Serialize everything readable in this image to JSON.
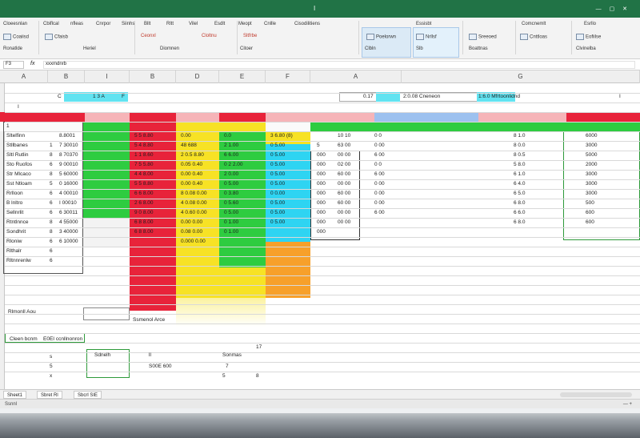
{
  "window": {
    "title": "I",
    "controls": "— ▢ ✕"
  },
  "ribbon": {
    "buttons": [
      "Cloeesnlan",
      "Cbiflcal",
      "nfleas",
      "Cnrpor",
      "Siinhs",
      "Bllt",
      "Rltt",
      "Vilel",
      "Esdlt",
      "Meopt",
      "Cnllle",
      "Cisodilitiens",
      "Comcnemlt",
      "Esrllo"
    ],
    "row2": [
      "Coaiisd",
      "Cfaisb",
      "Ceonxl",
      "Cloltnu",
      "Sltfrbe",
      "Poelorwn",
      "Nrllsf",
      "Sreeoed",
      "Cnttloas",
      "Eofiilse"
    ],
    "row3": [
      "Ronatlde",
      "Heriel",
      "Diomnen",
      "Citoer",
      "Clbln",
      "Slb",
      "Boattnas",
      "Clvinelba"
    ],
    "highlighted_group": "Essisbt"
  },
  "formula_bar": {
    "name_box": "F3",
    "fx": "fx",
    "value": "xxxmdnrb"
  },
  "columns": [
    "A",
    "B",
    "I",
    "B",
    "D",
    "E",
    "F",
    "A",
    "G"
  ],
  "cells": {
    "top_c": "C",
    "top_13": "1 3 A",
    "top_f": "F",
    "top_mid1": "0.17",
    "top_mid2": "2:0.08 Cneneon",
    "top_right": "1:6.0 Mfrtoonlidnd",
    "top_i": "I",
    "col_a_rows": [
      "1",
      "Sltelfinn",
      "Stllbanes",
      "Sltl Rutlin",
      "Sto Ruofos",
      "Str Mlcaco",
      "Sst Ntloam",
      "Rrlloon",
      "B lnltro",
      "Sellnrlit",
      "Rtntlnnce",
      "Sondhrit",
      "Rloniw",
      "Rlthalr",
      "Rltnnrenlw"
    ],
    "idx_rows": [
      "1",
      "8",
      "6",
      "8",
      "5",
      "6",
      "6",
      "6",
      "8",
      "8",
      "6",
      "6",
      "6"
    ],
    "green_rows": [
      "8.8001",
      "7 30010",
      "8 70370",
      "9 00010",
      "5 60000",
      "0 16000",
      "4 00010",
      "I 00010",
      "6 30011",
      "4 55000",
      "3 40000",
      "6 10000"
    ],
    "red_rows": [
      "5 5 8.80",
      "5 4 8.80",
      "1 1 8.60",
      "7 5 5.80",
      "4 4 8.00",
      "5 5 8.80",
      "6 6 8.00",
      "2 6 8.00",
      "9 0 8.00",
      "6 8 8.00",
      "6 8 8.00"
    ],
    "yellow_rows": [
      "0.00",
      "48 688",
      "2 0.5 8.80",
      "0.05 0.40",
      "0.00 0.40",
      "0.00 0.40",
      "8 0.08 0.00",
      "4 0.08 0.00",
      "4 0.60 0.00",
      "0.00 0.00",
      "0.08 0.00",
      "0.000 0.00"
    ],
    "e_rows": [
      "0.0",
      "2 1.00",
      "6 6.00",
      "0 2 2.00",
      "2 0.00",
      "0 5.00",
      "0 3.80",
      "0 5.60",
      "0 5.00",
      "0 1.00",
      "0 1.00"
    ],
    "f_rows": [
      "3 6.80 (8)",
      "0 5.00",
      "0 5.00",
      "0 5.00",
      "0 5.00",
      "0 5.00",
      "0 0.00",
      "0 5.00",
      "0 5.00",
      "0 5.00"
    ],
    "g_rows": [
      "5",
      "000",
      "000",
      "000",
      "000",
      "000",
      "000",
      "000",
      "000",
      "000"
    ],
    "h_rows": [
      "10 10",
      "63 00",
      "00 00",
      "02 00",
      "60 00",
      "00 00",
      "60 00",
      "60 00",
      "00 00",
      "00 00"
    ],
    "i_rows": [
      "0 0",
      "0 00",
      "6 00",
      "0 0",
      "6 00",
      "0 00",
      "0 00",
      "0 00",
      "6 00"
    ],
    "right_rows": [
      "8 1.0",
      "8 0.0",
      "8 0.5",
      "5 8.0",
      "6 1.0",
      "6 4.0",
      "6 5.0",
      "6 8.0",
      "6 6.0",
      "6 8.0"
    ],
    "far_right_rows": [
      "6000",
      "3000",
      "5000",
      "2000",
      "3000",
      "3000",
      "3000",
      "500",
      "600",
      "600"
    ],
    "bottom_left": "Cleen bcnm",
    "bottom_label": "E0EI ccnllnonron",
    "bottom_vals": [
      "s",
      "Sdnelh",
      "ll",
      "5",
      "Sonmas",
      "17",
      "x",
      "7",
      "S00E 600",
      "5",
      "8"
    ],
    "formula_note": "Ssmenol Arce",
    "sum_label": "Rlmonll Aou"
  },
  "tabs": [
    "Sheet1",
    "Sbret Rl",
    "Sbcrl SIE"
  ],
  "status": {
    "left": "Ssnnl",
    "right": "—  +"
  },
  "colors": {
    "excel_green": "#217346",
    "green": "#2ecc40",
    "red": "#e8233a",
    "yellow": "#f7e225",
    "orange": "#f7a02a",
    "cyan": "#2ed4f2",
    "pink": "#f6b4b8",
    "blue": "#9dc1ef"
  }
}
